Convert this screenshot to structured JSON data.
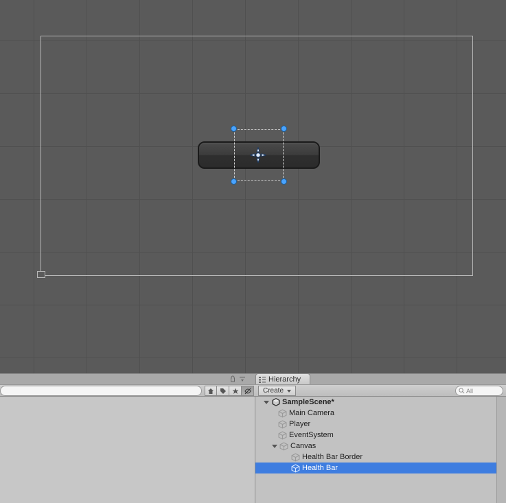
{
  "tabs": {
    "hierarchy": "Hierarchy"
  },
  "buttons": {
    "create": "Create"
  },
  "search": {
    "right_placeholder": "All"
  },
  "hierarchy": {
    "scene": "SampleScene*",
    "items": [
      "Main Camera",
      "Player",
      "EventSystem"
    ],
    "canvas": "Canvas",
    "canvas_children": [
      "Health Bar Border",
      "Health Bar"
    ]
  },
  "colors": {
    "selection": "#3e7de0",
    "scene_bg": "#5a5a5a",
    "handle_blue": "#4aa3ff"
  }
}
